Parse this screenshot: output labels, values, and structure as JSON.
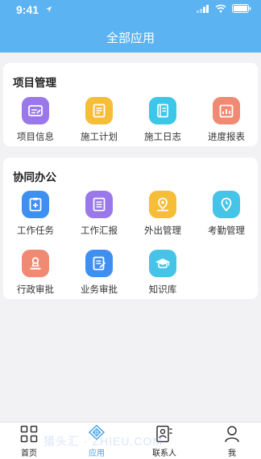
{
  "status_bar": {
    "time": "9:41"
  },
  "header": {
    "title": "全部应用"
  },
  "sections": [
    {
      "title": "项目管理",
      "apps": [
        {
          "label": "项目信息",
          "icon": "project-info-icon",
          "color": "#9b78ea"
        },
        {
          "label": "施工计划",
          "icon": "construction-plan-icon",
          "color": "#f5bd38"
        },
        {
          "label": "施工日志",
          "icon": "construction-log-icon",
          "color": "#3cc6e8"
        },
        {
          "label": "进度报表",
          "icon": "progress-report-icon",
          "color": "#f08a72"
        }
      ]
    },
    {
      "title": "协同办公",
      "apps": [
        {
          "label": "工作任务",
          "icon": "work-task-icon",
          "color": "#3f8ff0"
        },
        {
          "label": "工作汇报",
          "icon": "work-report-icon",
          "color": "#9a78ea"
        },
        {
          "label": "外出管理",
          "icon": "outing-management-icon",
          "color": "#f5bd38"
        },
        {
          "label": "考勤管理",
          "icon": "attendance-icon",
          "color": "#45c4e8"
        },
        {
          "label": "行政审批",
          "icon": "admin-approval-icon",
          "color": "#f08a72"
        },
        {
          "label": "业务审批",
          "icon": "business-approval-icon",
          "color": "#3f8ff0"
        },
        {
          "label": "知识库",
          "icon": "knowledge-base-icon",
          "color": "#45c4e8"
        }
      ]
    }
  ],
  "tabbar": {
    "items": [
      {
        "label": "首页",
        "icon": "home-grid-icon",
        "active": false
      },
      {
        "label": "应用",
        "icon": "apps-icon",
        "active": true
      },
      {
        "label": "联系人",
        "icon": "contacts-icon",
        "active": false
      },
      {
        "label": "我",
        "icon": "person-icon",
        "active": false
      }
    ]
  },
  "watermark": "猎头汇 · ZHIEU.COM",
  "colors": {
    "header_bg": "#5bb3f2",
    "active_tab": "#4aa3ea"
  }
}
